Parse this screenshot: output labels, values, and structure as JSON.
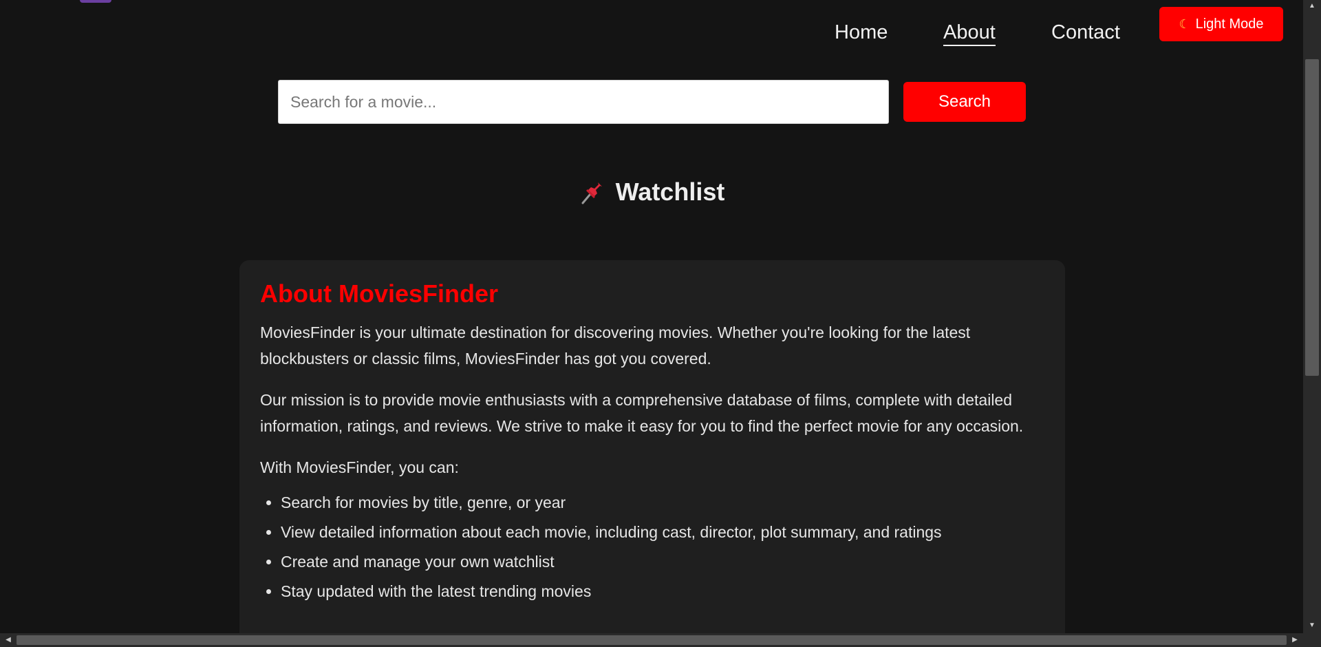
{
  "nav": {
    "links": [
      {
        "label": "Home"
      },
      {
        "label": "About"
      },
      {
        "label": "Contact"
      }
    ],
    "active": "About",
    "theme_button": {
      "icon": "moon-icon",
      "label": "Light Mode"
    }
  },
  "search": {
    "placeholder": "Search for a movie...",
    "value": "",
    "button_label": "Search"
  },
  "watchlist": {
    "icon": "pushpin-icon",
    "title": "Watchlist"
  },
  "about": {
    "title": "About MoviesFinder",
    "paragraphs": [
      "MoviesFinder is your ultimate destination for discovering movies. Whether you're looking for the latest blockbusters or classic films, MoviesFinder has got you covered.",
      "Our mission is to provide movie enthusiasts with a comprehensive database of films, complete with detailed information, ratings, and reviews. We strive to make it easy for you to find the perfect movie for any occasion.",
      "With MoviesFinder, you can:"
    ],
    "features": [
      "Search for movies by title, genre, or year",
      "View detailed information about each movie, including cast, director, plot summary, and ratings",
      "Create and manage your own watchlist",
      "Stay updated with the latest trending movies"
    ]
  },
  "colors": {
    "background": "#141414",
    "card": "#1f1f1f",
    "accent": "#ff0000",
    "text": "#e6e6e6"
  }
}
